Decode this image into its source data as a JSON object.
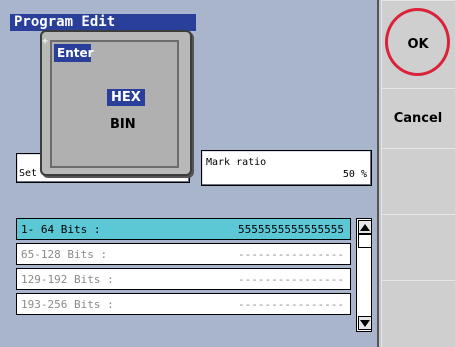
{
  "window": {
    "title": "Program Edit"
  },
  "popup": {
    "title": "Enter",
    "options": [
      "HEX",
      "BIN"
    ],
    "selected": "HEX"
  },
  "fields": {
    "set_label": "Set",
    "mark_ratio_label": "Mark ratio",
    "mark_ratio_value": "50 %"
  },
  "bits": [
    {
      "label": "1- 64 Bits :",
      "value": "5555555555555555"
    },
    {
      "label": "65-128 Bits :",
      "value": "----------------"
    },
    {
      "label": "129-192 Bits :",
      "value": "----------------"
    },
    {
      "label": "193-256 Bits :",
      "value": "----------------"
    }
  ],
  "side_buttons": {
    "ok": "OK",
    "cancel": "Cancel"
  },
  "colors": {
    "title_bar": "#2a3f9a",
    "selection": "#5cc8d6",
    "highlight_ring": "#d8233a"
  },
  "icons": {
    "scroll_up": "triangle-up-icon",
    "scroll_down": "triangle-down-icon"
  }
}
